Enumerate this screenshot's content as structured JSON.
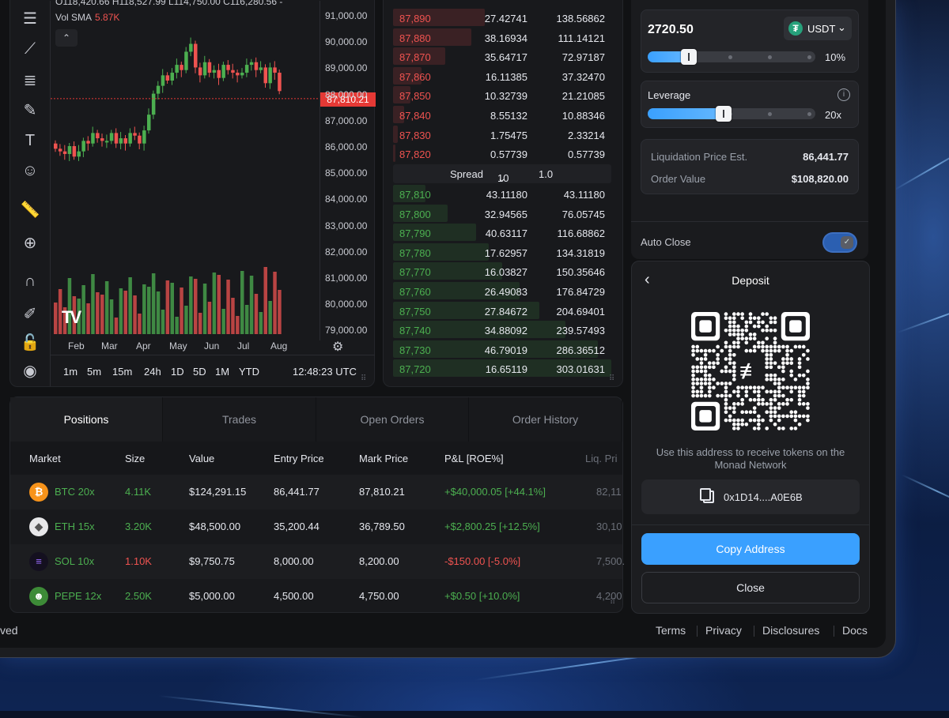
{
  "chart": {
    "ohlc_text": "O118,420.66  H118,527.99  L114,750.00  C116,280.56  -",
    "vol_label": "Vol SMA",
    "vol_value": "5.87K",
    "collapse_icon": "chevron-up-icon",
    "price_labels": [
      "91,000.00",
      "90,000.00",
      "89,000.00",
      "88,000.00",
      "87,000.00",
      "86,000.00",
      "85,000.00",
      "84,000.00",
      "83,000.00",
      "82,000.00",
      "81,000.00",
      "80,000.00",
      "79,000.00"
    ],
    "current_price": "87,810.21",
    "months": [
      "Feb",
      "Mar",
      "Apr",
      "May",
      "Jun",
      "Jul",
      "Aug"
    ],
    "timeframes": [
      "1m",
      "5m",
      "15m",
      "24h",
      "1D",
      "5D",
      "1M",
      "YTD"
    ],
    "clock": "12:48:23 UTC",
    "logo": "TV",
    "colors": {
      "up": "#4caf50",
      "down": "#ef5350",
      "price_tag": "#e53935"
    }
  },
  "toolbar": {
    "icons": [
      "menu-icon",
      "pattern-tool-icon",
      "fib-tool-icon",
      "brush-icon",
      "text-tool-icon",
      "emoji-icon",
      "ruler-icon",
      "zoom-in-icon",
      "magnet-icon",
      "lock-drawing-icon",
      "lock-icon",
      "eye-icon"
    ]
  },
  "order_book": {
    "asks": [
      {
        "price": "87,890",
        "size": "27.42741",
        "total": "138.56862",
        "depth": 0.42
      },
      {
        "price": "87,880",
        "size": "38.16934",
        "total": "111.14121",
        "depth": 0.36
      },
      {
        "price": "87,870",
        "size": "35.64717",
        "total": "72.97187",
        "depth": 0.24
      },
      {
        "price": "87,860",
        "size": "16.11385",
        "total": "37.32470",
        "depth": 0.13
      },
      {
        "price": "87,850",
        "size": "10.32739",
        "total": "21.21085",
        "depth": 0.08
      },
      {
        "price": "87,840",
        "size": "8.55132",
        "total": "10.88346",
        "depth": 0.05
      },
      {
        "price": "87,830",
        "size": "1.75475",
        "total": "2.33214",
        "depth": 0.02
      },
      {
        "price": "87,820",
        "size": "0.57739",
        "total": "0.57739",
        "depth": 0.01
      }
    ],
    "spread_label": "Spread",
    "spread_step": "10",
    "spread_value": "1.0",
    "bids": [
      {
        "price": "87,810",
        "size": "43.11180",
        "total": "43.11180",
        "depth": 0.15
      },
      {
        "price": "87,800",
        "size": "32.94565",
        "total": "76.05745",
        "depth": 0.25
      },
      {
        "price": "87,790",
        "size": "40.63117",
        "total": "116.68862",
        "depth": 0.38
      },
      {
        "price": "87,780",
        "size": "17.62957",
        "total": "134.31819",
        "depth": 0.44
      },
      {
        "price": "87,770",
        "size": "16.03827",
        "total": "150.35646",
        "depth": 0.5
      },
      {
        "price": "87,760",
        "size": "26.49083",
        "total": "176.84729",
        "depth": 0.58
      },
      {
        "price": "87,750",
        "size": "27.84672",
        "total": "204.69401",
        "depth": 0.67
      },
      {
        "price": "87,740",
        "size": "34.88092",
        "total": "239.57493",
        "depth": 0.79
      },
      {
        "price": "87,730",
        "size": "46.79019",
        "total": "286.36512",
        "depth": 0.94
      },
      {
        "price": "87,720",
        "size": "16.65119",
        "total": "303.01631",
        "depth": 1.0
      }
    ]
  },
  "order": {
    "amount": "2720.50",
    "token": "USDT",
    "token_icon": "tether-icon",
    "size_fraction": 0.1,
    "size_label": "10%",
    "leverage_label": "Leverage",
    "leverage_fraction": 0.4,
    "leverage_value": "20x",
    "liq_label": "Liquidation Price Est.",
    "liq_value": "86,441.77",
    "order_value_label": "Order Value",
    "order_value": "$108,820.00",
    "auto_close_label": "Auto Close",
    "auto_close_on": true,
    "accent": "#3aa0ff"
  },
  "deposit": {
    "title": "Deposit",
    "description": "Use this address to receive tokens on the Monad Network",
    "address": "0x1D14....A0E6B",
    "copy_label": "Copy Address",
    "close_label": "Close"
  },
  "positions": {
    "tabs": [
      "Positions",
      "Trades",
      "Open Orders",
      "Order History"
    ],
    "active_tab": 0,
    "columns": [
      "Market",
      "Size",
      "Value",
      "Entry Price",
      "Mark Price",
      "P&L [ROE%]",
      "Liq. Pri"
    ],
    "rows": [
      {
        "icon": "btc-icon",
        "icon_char": "₿",
        "icon_color": "#f7931a",
        "market": "BTC 20x",
        "size": "4.11K",
        "value": "$124,291.15",
        "entry": "86,441.77",
        "mark": "87,810.21",
        "pnl": "+$40,000.05 [+44.1%]",
        "liq": "82,11",
        "positive": true
      },
      {
        "icon": "eth-icon",
        "icon_char": "◆",
        "icon_color": "#e8e8ea",
        "market": "ETH 15x",
        "size": "3.20K",
        "value": "$48,500.00",
        "entry": "35,200.44",
        "mark": "36,789.50",
        "pnl": "+$2,800.25 [+12.5%]",
        "liq": "30,10",
        "positive": true
      },
      {
        "icon": "sol-icon",
        "icon_char": "≡",
        "icon_color": "#14101f",
        "market": "SOL 10x",
        "size": "1.10K",
        "value": "$9,750.75",
        "entry": "8,000.00",
        "mark": "8,200.00",
        "pnl": "-$150.00 [-5.0%]",
        "liq": "7,500.",
        "positive": false
      },
      {
        "icon": "pepe-icon",
        "icon_char": "☻",
        "icon_color": "#3d8b37",
        "market": "PEPE 12x",
        "size": "2.50K",
        "value": "$5,000.00",
        "entry": "4,500.00",
        "mark": "4,750.00",
        "pnl": "+$0.50 [+10.0%]",
        "liq": "4,200",
        "positive": true
      }
    ]
  },
  "footer": {
    "left_text": "ved",
    "links": [
      "Terms",
      "Privacy",
      "Disclosures",
      "Docs"
    ]
  }
}
